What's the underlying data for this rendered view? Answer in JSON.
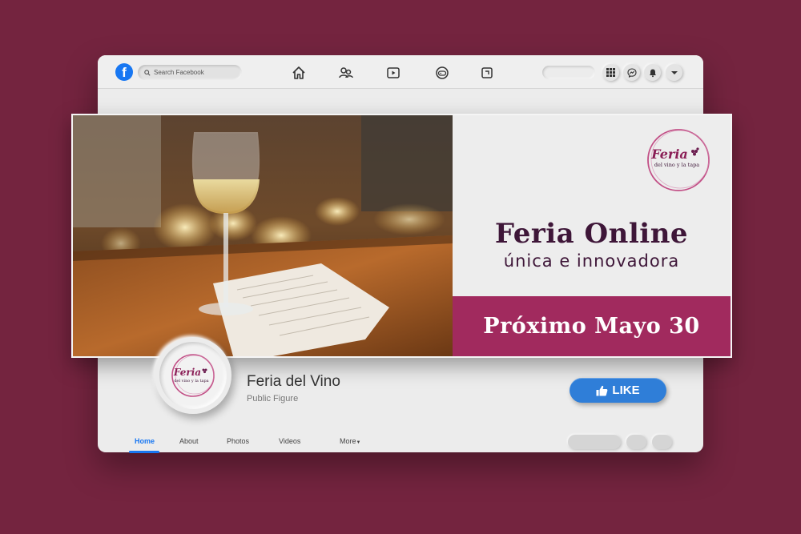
{
  "topbar": {
    "logo_letter": "f",
    "search_placeholder": "Search Facebook",
    "nav_icons": [
      "home-icon",
      "groups-icon",
      "watch-icon",
      "gaming-icon",
      "pages-icon"
    ],
    "right_icons": [
      "grid-menu-icon",
      "messenger-icon",
      "bell-icon",
      "chevron-down-icon"
    ]
  },
  "cover": {
    "logo": {
      "title": "Feria",
      "subtitle": "del vino y la tapa"
    },
    "headline": "Feria Online",
    "subheadline": "única e innovadora",
    "date_banner": "Próximo Mayo 30"
  },
  "profile": {
    "name": "Feria del Vino",
    "category": "Public Figure",
    "like_label": "LIKE"
  },
  "tabs": [
    {
      "label": "Home",
      "active": true
    },
    {
      "label": "About"
    },
    {
      "label": "Photos"
    },
    {
      "label": "Videos"
    },
    {
      "label": "More"
    }
  ],
  "colors": {
    "background": "#74243f",
    "brand_plum": "#3e1638",
    "accent_magenta": "#a12a5e",
    "facebook_blue": "#1877f2"
  }
}
